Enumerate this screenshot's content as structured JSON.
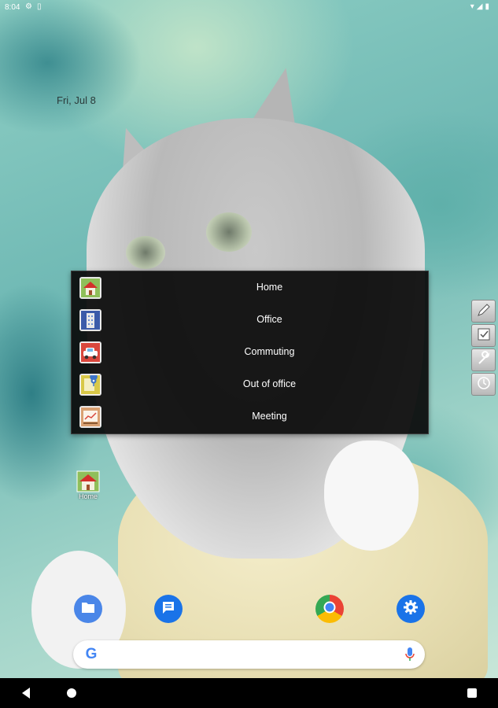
{
  "status_bar": {
    "time": "8:04",
    "left_icons": [
      "settings-icon",
      "sd-card-icon"
    ],
    "right_icons": [
      "wifi-icon",
      "signal-icon",
      "battery-icon"
    ]
  },
  "date_widget": {
    "text": "Fri, Jul 8"
  },
  "profile_menu": {
    "items": [
      {
        "label": "Home",
        "icon": "house-icon"
      },
      {
        "label": "Office",
        "icon": "office-building-icon"
      },
      {
        "label": "Commuting",
        "icon": "car-icon"
      },
      {
        "label": "Out of office",
        "icon": "map-pin-icon"
      },
      {
        "label": "Meeting",
        "icon": "chart-board-icon"
      }
    ]
  },
  "side_toolbar": {
    "buttons": [
      "pencil-icon",
      "check-note-icon",
      "wrench-icon",
      "clock-icon"
    ]
  },
  "home_shortcut": {
    "label": "Home",
    "icon": "house-icon"
  },
  "dock": {
    "apps": [
      {
        "name": "Files",
        "icon": "files-icon"
      },
      {
        "name": "Messages",
        "icon": "messages-icon"
      },
      {
        "name": "Chrome",
        "icon": "chrome-icon"
      },
      {
        "name": "Settings",
        "icon": "settings-gear-icon"
      }
    ]
  },
  "search_bar": {
    "icon": "google-g-icon",
    "g_letter": "G",
    "mic": "mic-icon"
  },
  "nav_bar": {
    "buttons": [
      "back-icon",
      "home-icon",
      "recents-icon"
    ]
  },
  "colors": {
    "menu_background": "#0a0a0a",
    "menu_text": "#ffffff",
    "accent_blue": "#1a73e8",
    "nav_bar": "#000000"
  }
}
